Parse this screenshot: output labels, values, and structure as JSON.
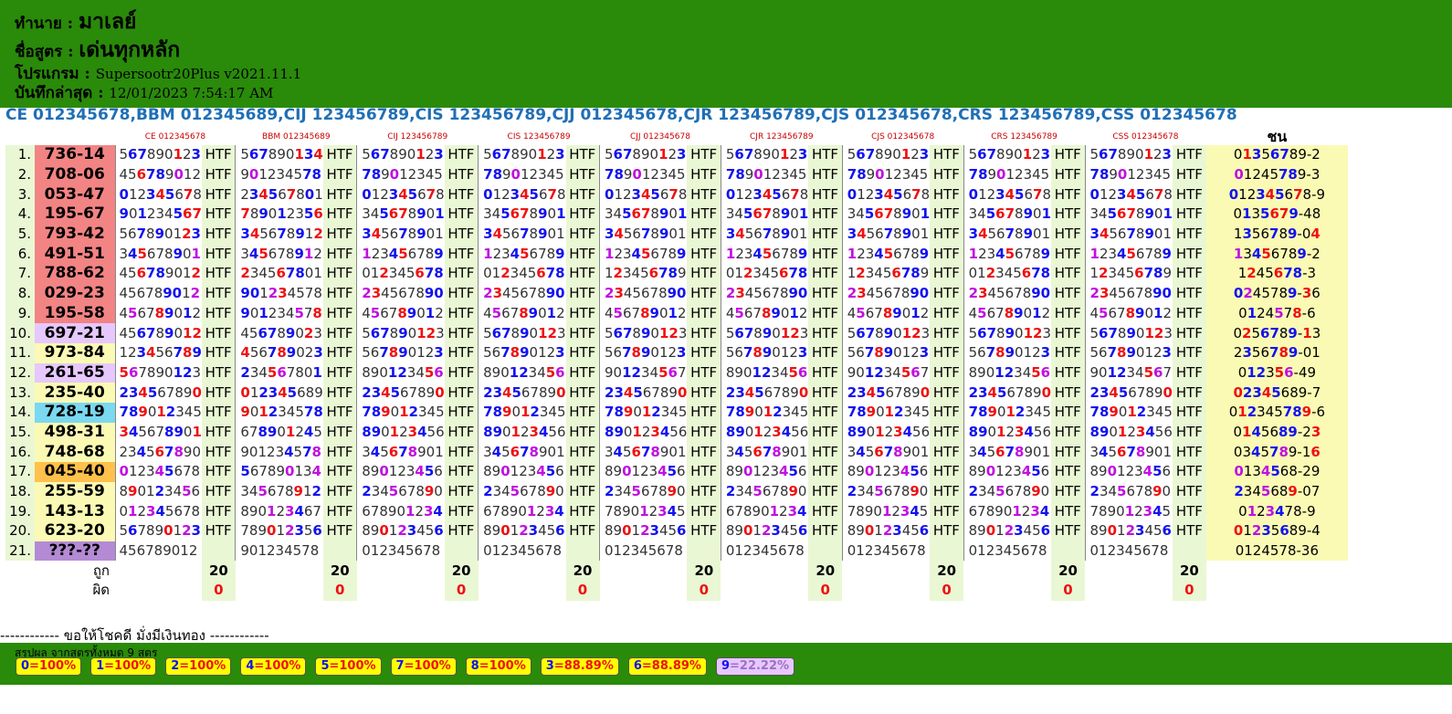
{
  "header": {
    "rows": [
      {
        "label": "ทำนาย :",
        "value": "มาเลย์",
        "big": true
      },
      {
        "label": "ชื่อสูตร :",
        "value": "เด่นทุกหลัก",
        "big": true
      },
      {
        "label": "โปรแกรม :",
        "value": "Supersootr20Plus v2021.11.1",
        "big": false
      },
      {
        "label": "บันทึกล่าสุด :",
        "value": "12/01/2023 7:54:17 AM",
        "big": false
      }
    ]
  },
  "formula_codes": [
    "CE 012345678",
    "BBM 012345689",
    "CIJ 123456789",
    "CIS 123456789",
    "CJJ 012345678",
    "CJR 123456789",
    "CJS 012345678",
    "CRS 123456789",
    "CSS 012345678"
  ],
  "column_headers": [
    "CE 012345678",
    "BBM 012345689",
    "CIJ 123456789",
    "CIS 123456789",
    "CJJ 012345678",
    "CJR 123456789",
    "CJS 012345678",
    "CRS 123456789",
    "CSS 012345678"
  ],
  "result_header": "ชน",
  "htf_label": "HTF",
  "rows": [
    {
      "n": "1.",
      "prize": "736-14",
      "bg": "#f28484",
      "cells": [
        "567890123",
        "567890134",
        "567890123",
        "567890123",
        "567890123",
        "567890123",
        "567890123",
        "567890123",
        "567890123"
      ],
      "res": "01356789-2"
    },
    {
      "n": "2.",
      "prize": "708-06",
      "bg": "#f28484",
      "cells": [
        "456789012",
        "901234578",
        "789012345",
        "789012345",
        "789012345",
        "789012345",
        "789012345",
        "789012345",
        "789012345"
      ],
      "res": "01245789-3"
    },
    {
      "n": "3.",
      "prize": "053-47",
      "bg": "#f28484",
      "cells": [
        "012345678",
        "234567801",
        "012345678",
        "012345678",
        "012345678",
        "012345678",
        "012345678",
        "012345678",
        "012345678"
      ],
      "res": "012345678-9"
    },
    {
      "n": "4.",
      "prize": "195-67",
      "bg": "#f28484",
      "cells": [
        "901234567",
        "789012356",
        "345678901",
        "345678901",
        "345678901",
        "345678901",
        "345678901",
        "345678901",
        "345678901"
      ],
      "res": "0135679-48"
    },
    {
      "n": "5.",
      "prize": "793-42",
      "bg": "#f28484",
      "cells": [
        "567890123",
        "345678912",
        "345678901",
        "345678901",
        "345678901",
        "345678901",
        "345678901",
        "345678901",
        "345678901"
      ],
      "res": "1356789-04"
    },
    {
      "n": "6.",
      "prize": "491-51",
      "bg": "#f28484",
      "cells": [
        "345678901",
        "345678912",
        "123456789",
        "123456789",
        "123456789",
        "123456789",
        "123456789",
        "123456789",
        "123456789"
      ],
      "res": "13456789-2"
    },
    {
      "n": "7.",
      "prize": "788-62",
      "bg": "#f28484",
      "cells": [
        "456789012",
        "234567801",
        "012345678",
        "012345678",
        "123456789",
        "012345678",
        "123456789",
        "012345678",
        "123456789"
      ],
      "res": "1245678-3"
    },
    {
      "n": "8.",
      "prize": "029-23",
      "bg": "#f28484",
      "cells": [
        "456789012",
        "901234578",
        "234567890",
        "234567890",
        "234567890",
        "234567890",
        "234567890",
        "234567890",
        "234567890"
      ],
      "res": "0245789-36"
    },
    {
      "n": "9.",
      "prize": "195-58",
      "bg": "#f28484",
      "cells": [
        "456789012",
        "901234578",
        "456789012",
        "456789012",
        "456789012",
        "456789012",
        "456789012",
        "456789012",
        "456789012"
      ],
      "res": "0124578-6"
    },
    {
      "n": "10.",
      "prize": "697-21",
      "bg": "#e6c8ff",
      "cells": [
        "456789012",
        "456789023",
        "567890123",
        "567890123",
        "567890123",
        "567890123",
        "567890123",
        "567890123",
        "567890123"
      ],
      "res": "0256789-13"
    },
    {
      "n": "11.",
      "prize": "973-84",
      "bg": "#fafab4",
      "cells": [
        "123456789",
        "456789023",
        "567890123",
        "567890123",
        "567890123",
        "567890123",
        "567890123",
        "567890123",
        "567890123"
      ],
      "res": "2356789-01"
    },
    {
      "n": "12.",
      "prize": "261-65",
      "bg": "#e6c8ff",
      "cells": [
        "567890123",
        "234567801",
        "890123456",
        "890123456",
        "901234567",
        "890123456",
        "901234567",
        "890123456",
        "901234567"
      ],
      "res": "012356-49"
    },
    {
      "n": "13.",
      "prize": "235-40",
      "bg": "#fafab4",
      "cells": [
        "234567890",
        "012345689",
        "234567890",
        "234567890",
        "234567890",
        "234567890",
        "234567890",
        "234567890",
        "234567890"
      ],
      "res": "02345689-7"
    },
    {
      "n": "14.",
      "prize": "728-19",
      "bg": "#7ad8f0",
      "cells": [
        "789012345",
        "901234578",
        "789012345",
        "789012345",
        "789012345",
        "789012345",
        "789012345",
        "789012345",
        "789012345"
      ],
      "res": "012345789-6"
    },
    {
      "n": "15.",
      "prize": "498-31",
      "bg": "#fafab4",
      "cells": [
        "345678901",
        "678901245",
        "890123456",
        "890123456",
        "890123456",
        "890123456",
        "890123456",
        "890123456",
        "890123456"
      ],
      "res": "0145689-23"
    },
    {
      "n": "16.",
      "prize": "748-68",
      "bg": "#fafab4",
      "cells": [
        "234567890",
        "901234578",
        "345678901",
        "345678901",
        "345678901",
        "345678901",
        "345678901",
        "345678901",
        "345678901"
      ],
      "res": "0345789-16"
    },
    {
      "n": "17.",
      "prize": "045-40",
      "bg": "#ffc04c",
      "cells": [
        "012345678",
        "567890134",
        "890123456",
        "890123456",
        "890123456",
        "890123456",
        "890123456",
        "890123456",
        "890123456"
      ],
      "res": "0134568-29"
    },
    {
      "n": "18.",
      "prize": "255-59",
      "bg": "#fafab4",
      "cells": [
        "890123456",
        "345678912",
        "234567890",
        "234567890",
        "234567890",
        "234567890",
        "234567890",
        "234567890",
        "234567890"
      ],
      "res": "2345689-07"
    },
    {
      "n": "19.",
      "prize": "143-13",
      "bg": "#fafab4",
      "cells": [
        "012345678",
        "890123467",
        "678901234",
        "678901234",
        "789012345",
        "678901234",
        "789012345",
        "678901234",
        "789012345"
      ],
      "res": "0123478-9"
    },
    {
      "n": "20.",
      "prize": "623-20",
      "bg": "#fafab4",
      "cells": [
        "567890123",
        "789012356",
        "890123456",
        "890123456",
        "890123456",
        "890123456",
        "890123456",
        "890123456",
        "890123456"
      ],
      "res": "01235689-4"
    },
    {
      "n": "21.",
      "prize": "???-??",
      "bg": "#b48ad4",
      "cells": [
        "456789012",
        "901234578",
        "012345678",
        "012345678",
        "012345678",
        "012345678",
        "012345678",
        "012345678",
        "012345678"
      ],
      "res": "0124578-36"
    }
  ],
  "correct_label": "ถูก",
  "wrong_label": "ผิด",
  "correct_counts": [
    "20",
    "20",
    "20",
    "20",
    "20",
    "20",
    "20",
    "20",
    "20"
  ],
  "wrong_counts": [
    "0",
    "0",
    "0",
    "0",
    "0",
    "0",
    "0",
    "0",
    "0"
  ],
  "blessing": "------------ ขอให้โชคดี มั่งมีเงินทอง ------------",
  "summary_title": "สรุปผล จากสูตรทั้งหมด 9 สูตร",
  "summary": [
    {
      "k": "0",
      "v": "100%"
    },
    {
      "k": "1",
      "v": "100%"
    },
    {
      "k": "2",
      "v": "100%"
    },
    {
      "k": "4",
      "v": "100%"
    },
    {
      "k": "5",
      "v": "100%"
    },
    {
      "k": "7",
      "v": "100%"
    },
    {
      "k": "8",
      "v": "100%"
    },
    {
      "k": "3",
      "v": "88.89%"
    },
    {
      "k": "6",
      "v": "88.89%"
    },
    {
      "k": "9",
      "v": "22.22%",
      "low": true
    }
  ]
}
